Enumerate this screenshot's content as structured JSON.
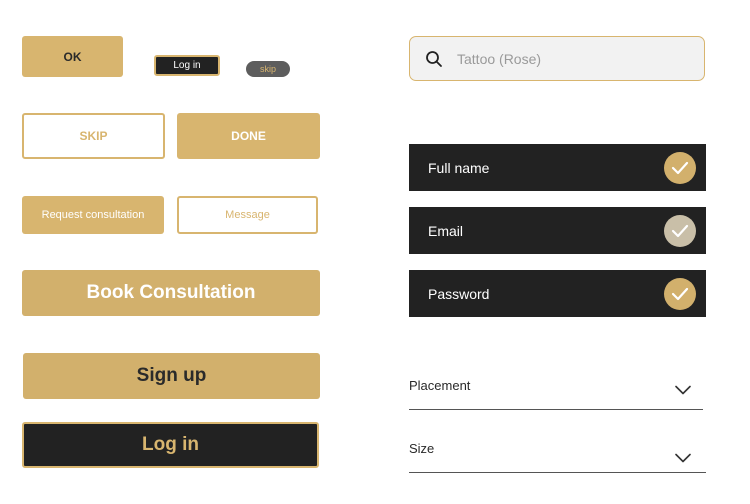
{
  "buttons": {
    "ok": "OK",
    "login_small": "Log in",
    "skip_pill": "skip",
    "skip": "SKIP",
    "done": "DONE",
    "request": "Request consultation",
    "message": "Message",
    "book": "Book Consultation",
    "signup": "Sign up",
    "login_large": "Log in"
  },
  "search": {
    "placeholder": "Tattoo (Rose)",
    "value": "",
    "icon": "search-icon"
  },
  "fields": [
    {
      "label": "Full name",
      "checked": true
    },
    {
      "label": "Email",
      "checked": true
    },
    {
      "label": "Password",
      "checked": true
    }
  ],
  "selects": {
    "placement": {
      "label": "Placement",
      "icon": "chevron-down-icon"
    },
    "size": {
      "label": "Size",
      "icon": "chevron-down-icon"
    }
  },
  "colors": {
    "accent_gold": "#d8b56f",
    "dark": "#222222",
    "pill_gray": "#5d5d5d",
    "search_bg": "#f2f2f2"
  }
}
